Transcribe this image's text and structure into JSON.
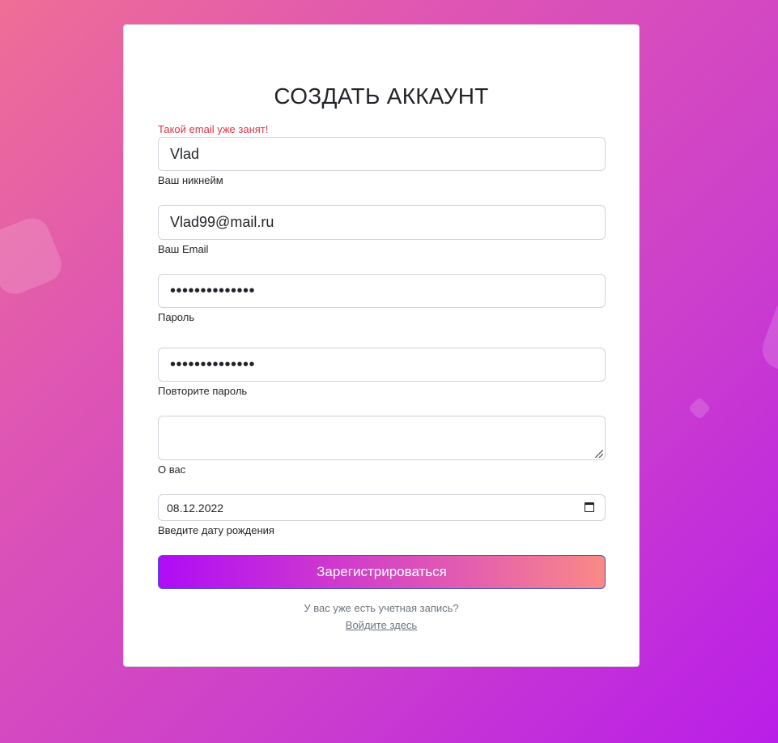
{
  "form": {
    "title": "СОЗДАТЬ АККАУНТ",
    "error_message": "Такой email уже занят!",
    "nickname": {
      "value": "Vlad",
      "label": "Ваш никнейм"
    },
    "email": {
      "value": "Vlad99@mail.ru",
      "label": "Ваш Email"
    },
    "password": {
      "masked_value": "••••••••••••••",
      "label": "Пароль"
    },
    "password_repeat": {
      "masked_value": "••••••••••••••",
      "label": "Повторите пароль"
    },
    "about": {
      "value": "",
      "label": "О вас"
    },
    "birthdate": {
      "value": "08.12.2022",
      "label": "Введите дату рождения",
      "icon": "calendar-icon"
    },
    "submit_label": "Зарегистрироваться",
    "have_account_text": "У вас уже есть учетная запись?",
    "login_link": "Войдите здесь"
  },
  "colors": {
    "background_start": "#ee6e96",
    "background_end": "#b91ee8",
    "error": "#dc3545",
    "button_start": "#b00bf7",
    "button_end": "#f98a86"
  }
}
